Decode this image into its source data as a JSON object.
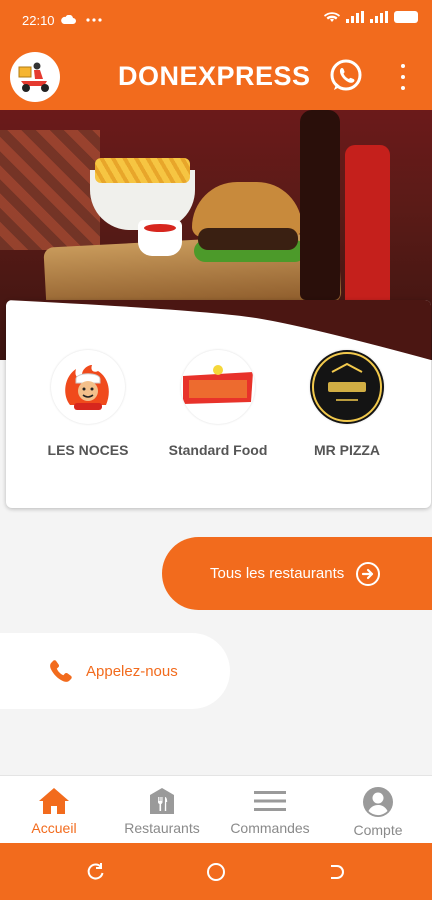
{
  "status_bar": {
    "time": "22:10",
    "icons": [
      "cloud-icon",
      "more-dots-icon",
      "wifi-icon",
      "signal-icon",
      "signal-icon",
      "battery-icon"
    ]
  },
  "app_bar": {
    "title": "DONEXPRESS",
    "icons": [
      "logo-delivery-scooter",
      "whatsapp-icon",
      "kebab-menu-icon"
    ]
  },
  "restaurants": [
    {
      "name": "LES NOCES",
      "logo": "chef-mascot-logo"
    },
    {
      "name": "Standard Food",
      "logo": "standard-foods-logo"
    },
    {
      "name": "MR PIZZA",
      "logo": "mr-pizza-logo"
    }
  ],
  "actions": {
    "all_restaurants": "Tous les restaurants",
    "call_us": "Appelez-nous"
  },
  "bottom_nav": [
    {
      "label": "Accueil",
      "icon": "home-icon",
      "active": true
    },
    {
      "label": "Restaurants",
      "icon": "restaurant-icon",
      "active": false
    },
    {
      "label": "Commandes",
      "icon": "menu-lines-icon",
      "active": false
    },
    {
      "label": "Compte",
      "icon": "account-icon",
      "active": false
    }
  ],
  "colors": {
    "primary": "#f26b1d",
    "inactive": "#8a8a8a"
  }
}
